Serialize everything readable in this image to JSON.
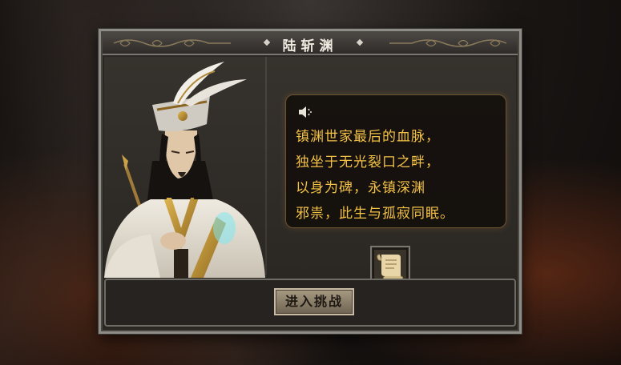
{
  "dialog": {
    "title": "陆斩渊",
    "speech_lines": [
      "镇渊世家最后的血脉，",
      "独坐于无光裂口之畔，",
      "以身为碑，永镇深渊",
      "邪祟，此生与孤寂同眠。"
    ],
    "enter_button_label": "进入挑战"
  },
  "icons": {
    "speaker": "speaker-icon",
    "item": "scroll-item-icon"
  },
  "colors": {
    "speech_text": "#f2c146",
    "frame": "#8e8c86",
    "title_text": "#f0ebe0"
  }
}
